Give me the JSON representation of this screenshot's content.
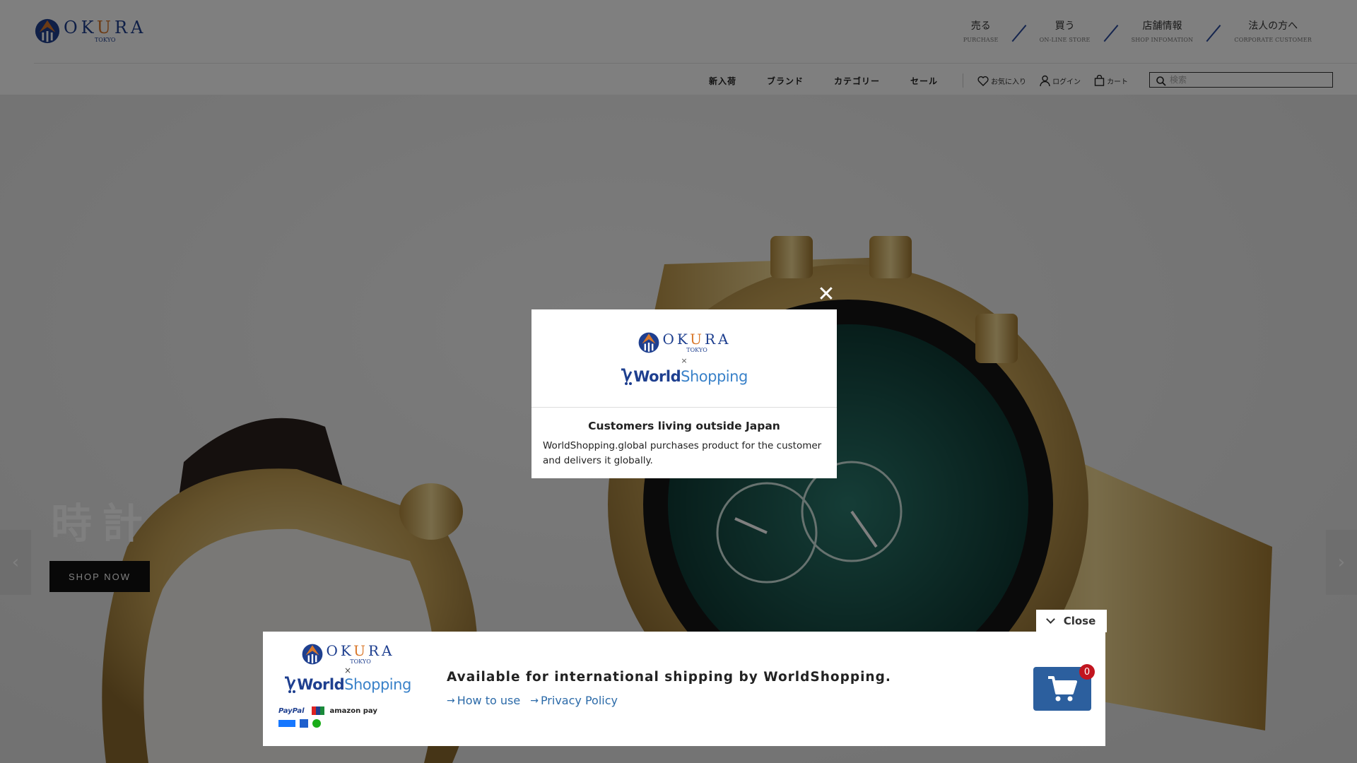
{
  "brand": {
    "name": "OKURA",
    "sub": "TOKYO",
    "colors": {
      "navy": "#1e3f8f",
      "orange": "#d9772a",
      "worldshopping_blue": "#3a82c9"
    }
  },
  "top_nav": [
    {
      "jp": "売る",
      "en": "PURCHASE"
    },
    {
      "jp": "買う",
      "en": "ON-LINE STORE"
    },
    {
      "jp": "店舗情報",
      "en": "SHOP INFOMATION"
    },
    {
      "jp": "法人の方へ",
      "en": "CORPORATE CUSTOMER"
    }
  ],
  "sub_nav": [
    "新入荷",
    "ブランド",
    "カテゴリー",
    "セール"
  ],
  "utility": {
    "favorites": "お気に入り",
    "login": "ログイン",
    "cart": "カート"
  },
  "search": {
    "placeholder": "検索"
  },
  "hero": {
    "title": "時計",
    "cta": "SHOP NOW",
    "prev_icon": "chevron-left-icon",
    "next_icon": "chevron-right-icon"
  },
  "modal": {
    "brand": "OKURA",
    "brand_sub": "TOKYO",
    "times": "×",
    "partner_prefix": "World",
    "partner_suffix": "Shopping",
    "title": "Customers living outside Japan",
    "text": "WorldShopping.global purchases product for the customer and delivers it globally.",
    "close_icon": "close-icon"
  },
  "banner": {
    "close_label": "Close",
    "brand": "OKURA",
    "brand_sub": "TOKYO",
    "times": "×",
    "partner_prefix": "World",
    "partner_suffix": "Shopping",
    "headline": "Available for international shipping by WorldShopping.",
    "links": [
      "How to use",
      "Privacy Policy"
    ],
    "payments": [
      "PayPal",
      "amazon pay"
    ],
    "cart_count": "0"
  }
}
